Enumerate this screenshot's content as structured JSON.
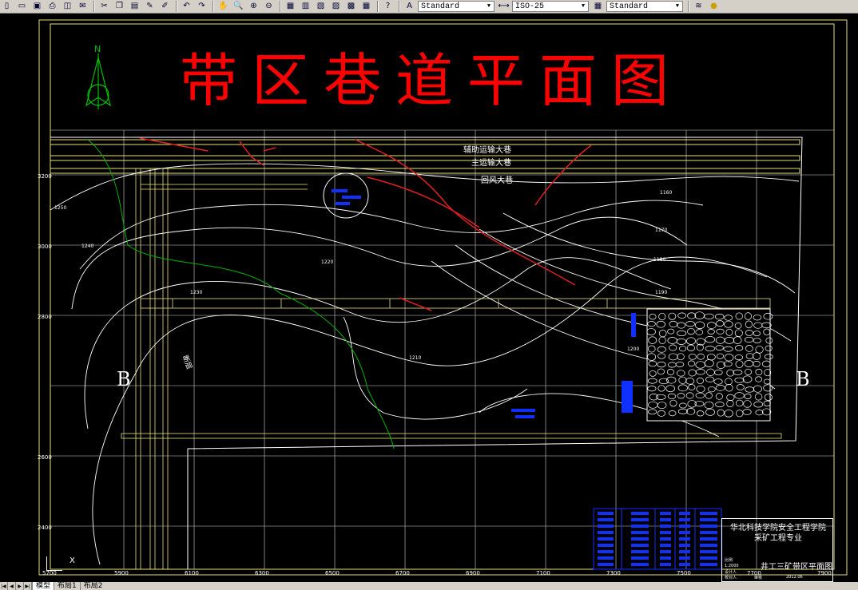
{
  "toolbar": {
    "text_style": "Standard",
    "dim_style": "ISO-25",
    "table_style": "Standard",
    "buttons": [
      "new-icon",
      "open-icon",
      "save-icon",
      "print-icon",
      "preview-icon",
      "publish-icon",
      "cut-icon",
      "copy-icon",
      "paste-icon",
      "matchprop-icon",
      "undo-icon",
      "redo-icon",
      "pan-icon",
      "zoom-realtime-icon",
      "zoom-window-icon",
      "zoom-previous-icon",
      "properties-icon",
      "designcenter-icon",
      "toolpalettes-icon",
      "sheetset-icon",
      "markup-icon",
      "calculator-icon",
      "help-icon"
    ]
  },
  "drawing": {
    "title": "带区巷道平面图",
    "north_label": "N",
    "section_left": "B",
    "section_right": "B",
    "roadways": {
      "aux_transport": "辅助运输大巷",
      "main_transport": "主运输大巷",
      "return_air": "回风大巷"
    },
    "fault_label": "断层",
    "contours": [
      "1160",
      "1170",
      "1180",
      "1190",
      "1200",
      "1210",
      "1220",
      "1230",
      "1240",
      "1250"
    ],
    "x_grid_labels": [
      "5700",
      "5900",
      "6100",
      "6300",
      "6500",
      "6700",
      "6900",
      "7100",
      "7300",
      "7500",
      "7700",
      "7900"
    ],
    "y_grid_labels": [
      "2400",
      "2600",
      "2800",
      "3000",
      "3200"
    ]
  },
  "title_block": {
    "school": "华北科技学院安全工程学院",
    "major": "采矿工程专业",
    "drawing_name": "井工三矿带区平面图",
    "scale_label": "比例",
    "scale_value": "1:2000",
    "designer": "设计人",
    "checker": "校对人",
    "reviewer": "审核",
    "date": "2012.06"
  },
  "tabs": [
    "模型",
    "布局1",
    "布局2"
  ],
  "colors": {
    "title_red": "#ff0000",
    "frame_yellow": "#e8e07a",
    "contour_white": "#ffffff",
    "goaf_green": "#00b000",
    "fault_red": "#e02020",
    "equipment_blue": "#1030ff"
  }
}
